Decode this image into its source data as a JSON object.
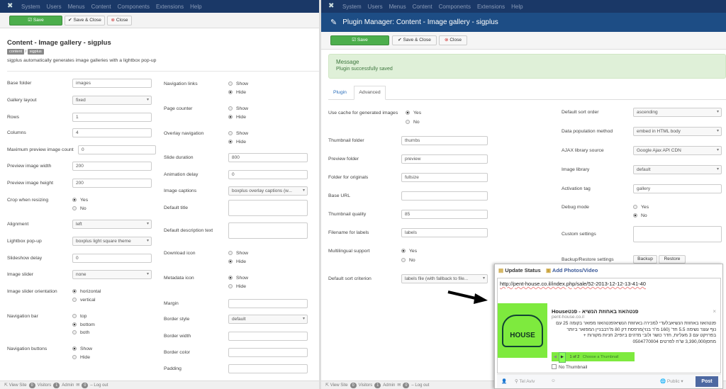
{
  "menu": [
    "System",
    "Users",
    "Menus",
    "Content",
    "Components",
    "Extensions",
    "Help"
  ],
  "toolbar": {
    "save": "Save",
    "save_close": "Save & Close",
    "close": "Close"
  },
  "left": {
    "title": "Content - Image gallery - sigplus",
    "tags": [
      "content",
      "sigplus"
    ],
    "description": "sigplus automatically generates image galleries with a lightbox pop-up",
    "col1": [
      {
        "label": "Base folder",
        "type": "text",
        "value": "images"
      },
      {
        "label": "Gallery layout",
        "type": "select",
        "value": "fixed"
      },
      {
        "label": "Rows",
        "type": "text",
        "value": "1"
      },
      {
        "label": "Columns",
        "type": "text",
        "value": "4"
      },
      {
        "label": "Maximum preview image count",
        "type": "text",
        "value": "0"
      },
      {
        "label": "Preview image width",
        "type": "text",
        "value": "200"
      },
      {
        "label": "Preview image height",
        "type": "text",
        "value": "200"
      },
      {
        "label": "Crop when resizing",
        "type": "radio",
        "options": [
          "Yes",
          "No"
        ],
        "selected": 0
      },
      {
        "label": "Alignment",
        "type": "select",
        "value": "left"
      },
      {
        "label": "Lightbox pop-up",
        "type": "select",
        "value": "boxplus light square theme"
      },
      {
        "label": "Slideshow delay",
        "type": "text",
        "value": "0"
      },
      {
        "label": "Image slider",
        "type": "select",
        "value": "none"
      },
      {
        "label": "Image slider orientation",
        "type": "radio",
        "options": [
          "horizontal",
          "vertical"
        ],
        "selected": 0
      },
      {
        "label": "Navigation bar",
        "type": "radio",
        "options": [
          "top",
          "bottom",
          "both"
        ],
        "selected": 1
      },
      {
        "label": "Navigation buttons",
        "type": "radio",
        "options": [
          "Show",
          "Hide"
        ],
        "selected": 0
      }
    ],
    "col2": [
      {
        "label": "Navigation links",
        "type": "radio",
        "options": [
          "Show",
          "Hide"
        ],
        "selected": 1
      },
      {
        "label": "Page counter",
        "type": "radio",
        "options": [
          "Show",
          "Hide"
        ],
        "selected": 1
      },
      {
        "label": "Overlay navigation",
        "type": "radio",
        "options": [
          "Show",
          "Hide"
        ],
        "selected": 1
      },
      {
        "label": "Slide duration",
        "type": "text",
        "value": "800"
      },
      {
        "label": "Animation delay",
        "type": "text",
        "value": "0"
      },
      {
        "label": "Image captions",
        "type": "select",
        "value": "boxplus overlay captions (w..."
      },
      {
        "label": "Default title",
        "type": "textarea",
        "value": ""
      },
      {
        "label": "Default description text",
        "type": "textarea",
        "value": ""
      },
      {
        "label": "Download icon",
        "type": "radio",
        "options": [
          "Show",
          "Hide"
        ],
        "selected": 1
      },
      {
        "label": "Metadata icon",
        "type": "radio",
        "options": [
          "Show",
          "Hide"
        ],
        "selected": 0
      },
      {
        "label": "Margin",
        "type": "text",
        "value": ""
      },
      {
        "label": "Border style",
        "type": "select",
        "value": "default"
      },
      {
        "label": "Border width",
        "type": "text",
        "value": ""
      },
      {
        "label": "Border color",
        "type": "text",
        "value": ""
      },
      {
        "label": "Padding",
        "type": "text",
        "value": ""
      }
    ]
  },
  "right": {
    "header": "Plugin Manager: Content - Image gallery - sigplus",
    "message_title": "Message",
    "message_text": "Plugin successfully saved",
    "tabs": [
      "Plugin",
      "Advanced"
    ],
    "active_tab": 1,
    "col1": [
      {
        "label": "Use cache for generated images",
        "type": "radio",
        "options": [
          "Yes",
          "No"
        ],
        "selected": 0
      },
      {
        "label": "Thumbnail folder",
        "type": "text",
        "value": "thumbs"
      },
      {
        "label": "Preview folder",
        "type": "text",
        "value": "preview"
      },
      {
        "label": "Folder for originals",
        "type": "text",
        "value": "fullsize"
      },
      {
        "label": "Base URL",
        "type": "text",
        "value": ""
      },
      {
        "label": "Thumbnail quality",
        "type": "text",
        "value": "85"
      },
      {
        "label": "Filename for labels",
        "type": "text",
        "value": "labels"
      },
      {
        "label": "Multilingual support",
        "type": "radio",
        "options": [
          "Yes",
          "No"
        ],
        "selected": 0
      },
      {
        "label": "Default sort criterion",
        "type": "select",
        "value": "labels file (with fallback to file..."
      }
    ],
    "col2": [
      {
        "label": "Default sort order",
        "type": "select",
        "value": "ascending"
      },
      {
        "label": "Data population method",
        "type": "select",
        "value": "embed in HTML body"
      },
      {
        "label": "AJAX library source",
        "type": "select",
        "value": "Google Ajax API CDN"
      },
      {
        "label": "Image library",
        "type": "select",
        "value": "default"
      },
      {
        "label": "Activation tag",
        "type": "text",
        "value": "gallery"
      },
      {
        "label": "Debug mode",
        "type": "radio",
        "options": [
          "Yes",
          "No"
        ],
        "selected": 1
      },
      {
        "label": "Custom settings",
        "type": "textarea",
        "value": ""
      },
      {
        "label": "Backup/Restore settings",
        "type": "buttons",
        "options": [
          "Backup",
          "Restore"
        ]
      }
    ]
  },
  "status": {
    "view_site": "View Site",
    "visitors_count": "0",
    "visitors": "Visitors",
    "admin_count": "1",
    "admin": "Admin",
    "messages_count": "0",
    "logout": "Log out"
  },
  "facebook": {
    "update_status": "Update Status",
    "add_photos": "Add Photos/Video",
    "url": "http://pent-house.co.il/index.php/sale/52-2013-12-12-13-41-40",
    "link_title": "פנטהאוז באחוזת הנשיא - פנטHouse",
    "link_domain": "pent-house.co.il",
    "link_desc": "פנטהאוז באחוזת הנשיאבלעדי למכירה באחוזת הנשיא!פנטהאוז מפואר בקומה 25 עם נוף עוצר נשימה 5.5 חד' (160 מ\"ר בנוי)מרפסת דק 80 מ\"רבבניין המפואר ביותר בפרויקט עם 3 מעליות, חדר כושר ולובי מדהים ביופיו2 חניות מקורות + מחסן3,390,000 ש\"ח לפרטים 0504770004",
    "logo_text": "HOUSE",
    "thumb_counter": "1 of 2",
    "choose_thumb": "Choose a Thumbnail",
    "no_thumbnail": "No Thumbnail",
    "location": "Tel Aviv",
    "audience": "Public",
    "post": "Post"
  }
}
